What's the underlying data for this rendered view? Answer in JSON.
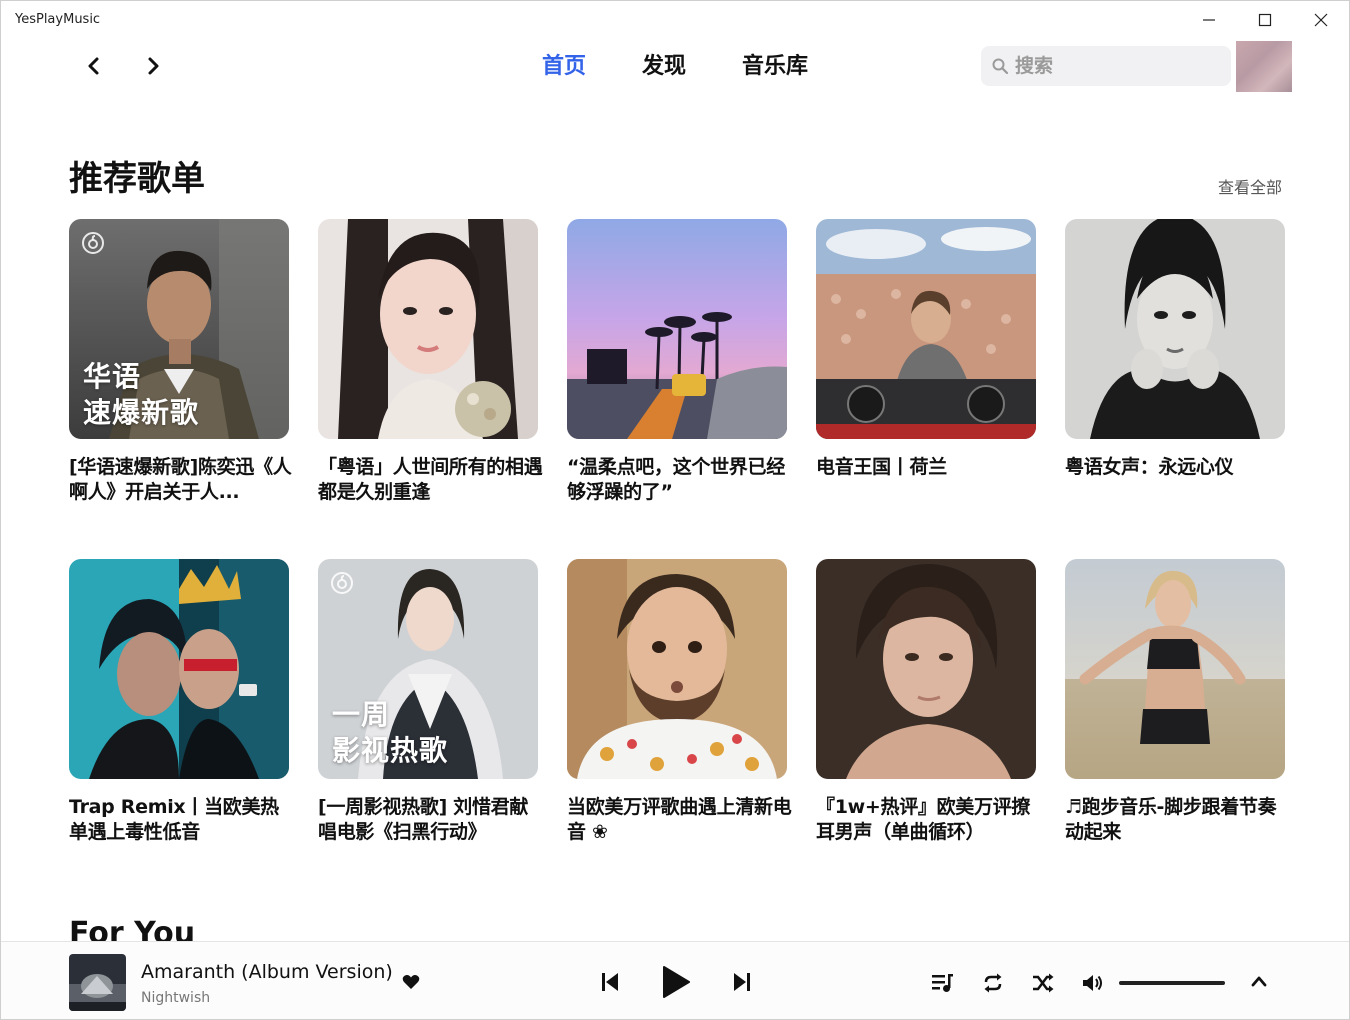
{
  "window": {
    "title": "YesPlayMusic"
  },
  "nav": {
    "tabs": [
      {
        "label": "首页",
        "active": true
      },
      {
        "label": "发现",
        "active": false
      },
      {
        "label": "音乐库",
        "active": false
      }
    ],
    "search_placeholder": "搜索"
  },
  "section": {
    "title": "推荐歌单",
    "see_all": "查看全部"
  },
  "playlists": [
    {
      "title": "[华语速爆新歌]陈奕迅《人啊人》开启关于人...",
      "cover_text": [
        "华语",
        "速爆新歌"
      ]
    },
    {
      "title": "「粤语」人世间所有的相遇 都是久别重逢"
    },
    {
      "title": "“温柔点吧，这个世界已经够浮躁的了”"
    },
    {
      "title": "电音王国丨荷兰"
    },
    {
      "title": "粤语女声：永远心仪"
    },
    {
      "title": "Trap Remix丨当欧美热单遇上毒性低音"
    },
    {
      "title": "[一周影视热歌] 刘惜君献唱电影《扫黑行动》",
      "cover_text": [
        "一周",
        "影视热歌"
      ]
    },
    {
      "title": "当欧美万评歌曲遇上清新电音 ❀"
    },
    {
      "title": "『1w+热评』欧美万评撩耳男声（单曲循环）"
    },
    {
      "title": "♬跑步音乐-脚步跟着节奏动起来"
    }
  ],
  "for_you": {
    "title": "For You"
  },
  "player": {
    "track_title": "Amaranth (Album Version)",
    "artist": "Nightwish",
    "volume": 1.0
  },
  "colors": {
    "accent": "#3363e8"
  }
}
